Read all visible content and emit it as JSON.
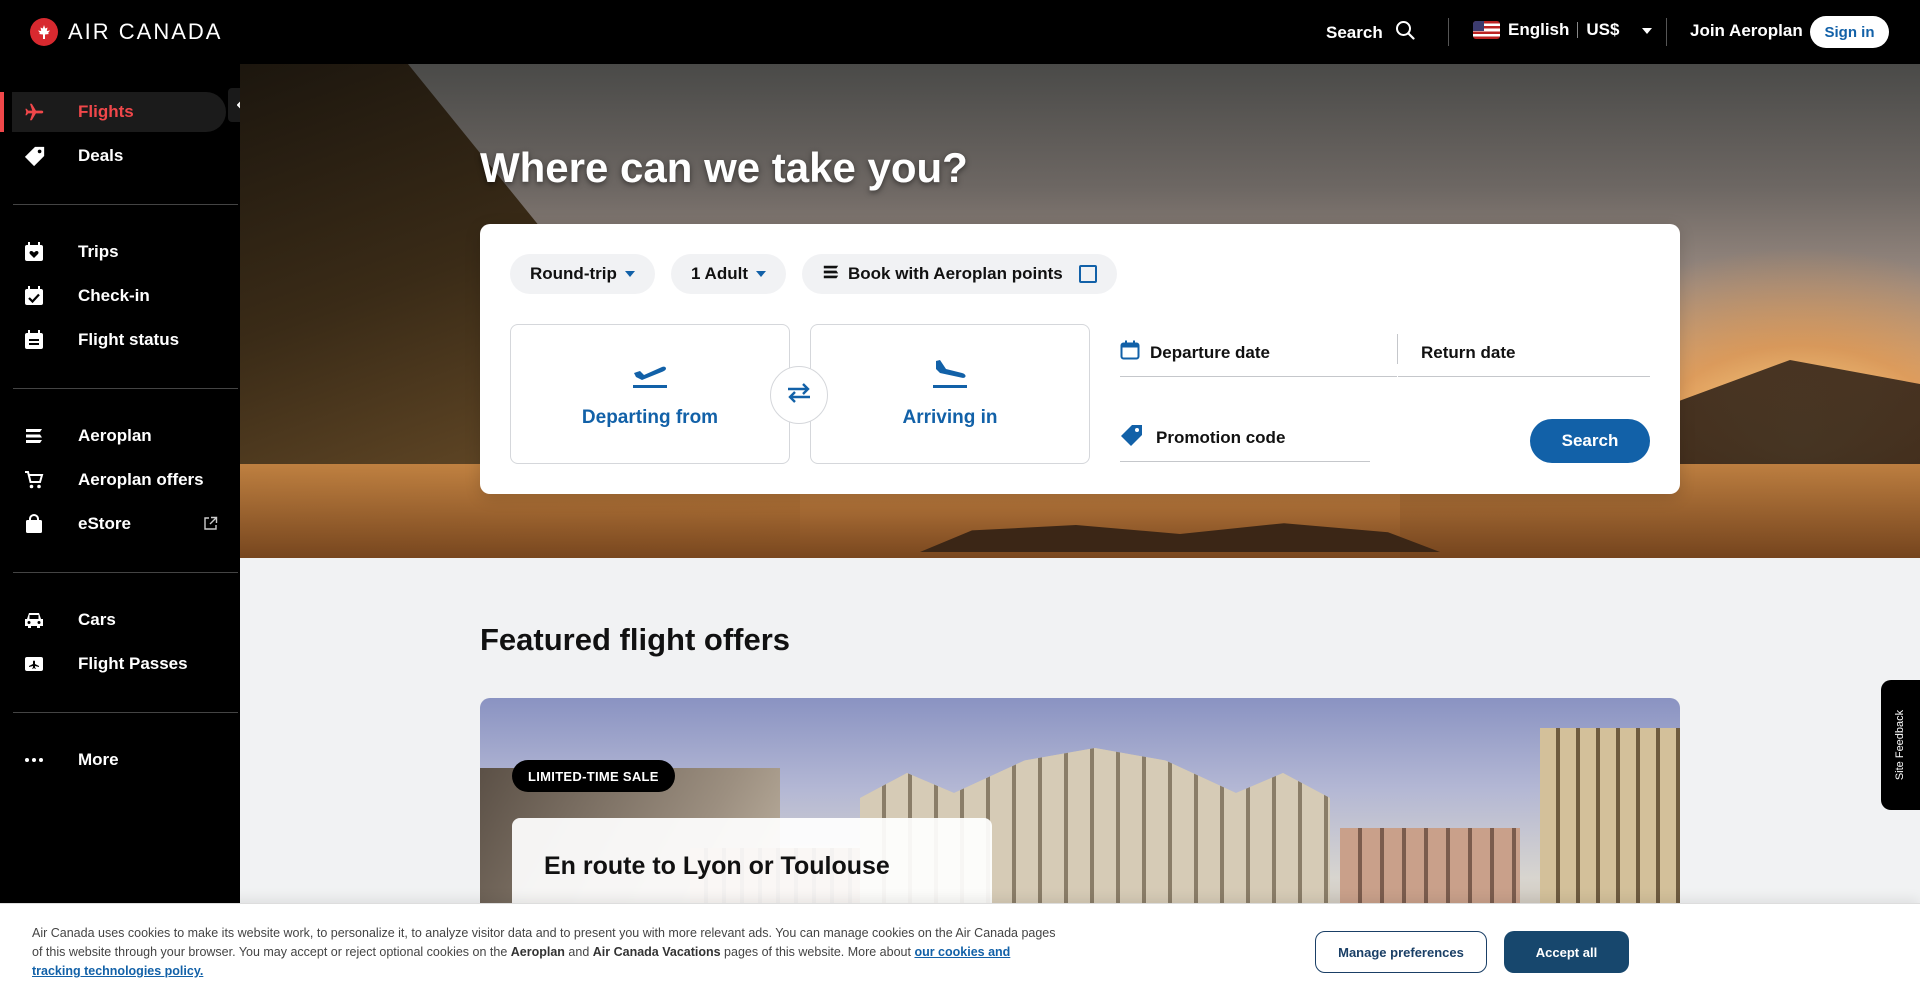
{
  "header": {
    "brand": "AIR CANADA",
    "search_label": "Search",
    "language": "English",
    "currency": "US$",
    "join_label": "Join Aeroplan",
    "signin_label": "Sign in"
  },
  "sidebar": {
    "items": [
      {
        "label": "Flights",
        "icon": "plane-icon"
      },
      {
        "label": "Deals",
        "icon": "tag-icon"
      },
      {
        "label": "Trips",
        "icon": "calendar-heart-icon"
      },
      {
        "label": "Check-in",
        "icon": "calendar-check-icon"
      },
      {
        "label": "Flight status",
        "icon": "status-list-icon"
      },
      {
        "label": "Aeroplan",
        "icon": "aeroplan-icon"
      },
      {
        "label": "Aeroplan offers",
        "icon": "cart-icon"
      },
      {
        "label": "eStore",
        "icon": "bag-icon"
      },
      {
        "label": "Cars",
        "icon": "car-icon"
      },
      {
        "label": "Flight Passes",
        "icon": "ticket-icon"
      },
      {
        "label": "More",
        "icon": "more-dots-icon"
      }
    ],
    "active": "Flights"
  },
  "hero": {
    "title": "Where can we take you?"
  },
  "booking": {
    "trip_type": "Round-trip",
    "passengers": "1 Adult",
    "points_label": "Book with Aeroplan points",
    "departing_label": "Departing from",
    "arriving_label": "Arriving in",
    "departure_date_label": "Departure date",
    "return_date_label": "Return date",
    "promo_label": "Promotion code",
    "search_label": "Search"
  },
  "featured": {
    "title": "Featured flight offers",
    "badge": "LIMITED-TIME SALE",
    "offer_title": "En route to Lyon or Toulouse"
  },
  "feedback": {
    "label": "Site Feedback"
  },
  "cookie": {
    "text_1": "Air Canada uses cookies to make its website work, to personalize it, to analyze visitor data and to present you with more relevant ads. You can manage cookies on the Air Canada pages of this website through your browser. You may accept or reject optional cookies on the ",
    "bold_1": "Aeroplan",
    "text_2": " and ",
    "bold_2": "Air Canada Vacations",
    "text_3": " pages of this website. More about ",
    "link": "our cookies and tracking technologies policy.",
    "manage_label": "Manage preferences",
    "accept_label": "Accept all"
  },
  "colors": {
    "brand_red": "#d8292f",
    "active_red": "#f0474a",
    "primary_blue": "#1261a8",
    "accept_blue": "#17476d"
  }
}
